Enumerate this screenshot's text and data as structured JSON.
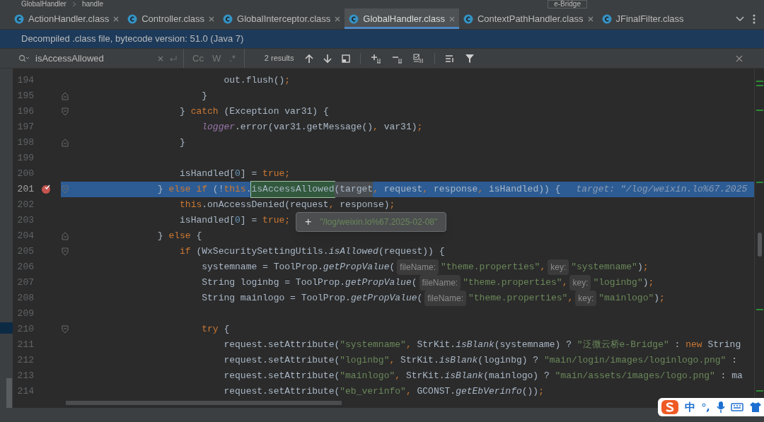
{
  "breadcrumb": [
    "GlobalHandler",
    "handle"
  ],
  "run_config": "e-Bridge",
  "tabs": [
    {
      "label": "ActionHandler.class",
      "selected": false,
      "closable": true
    },
    {
      "label": "Controller.class",
      "selected": false,
      "closable": true
    },
    {
      "label": "GlobalInterceptor.class",
      "selected": false,
      "closable": true
    },
    {
      "label": "GlobalHandler.class",
      "selected": true,
      "closable": true
    },
    {
      "label": "ContextPathHandler.class",
      "selected": false,
      "closable": true
    },
    {
      "label": "JFinalFilter.class",
      "selected": false,
      "closable": false
    }
  ],
  "banner": "Decompiled .class file, bytecode version: 51.0 (Java 7)",
  "search": {
    "query": "isAccessAllowed",
    "toggles": [
      "Cc",
      "W",
      ".*"
    ],
    "results": "2 results"
  },
  "lines": [
    {
      "number": "194",
      "kind": "plain",
      "current": false,
      "breakpoint": false,
      "tokens": [
        {
          "kind": "plain",
          "text": "                            out.flush()"
        },
        {
          "kind": "punct",
          "text": ";"
        }
      ]
    },
    {
      "number": "195",
      "kind": "fold-end",
      "current": false,
      "breakpoint": false,
      "tokens": [
        {
          "kind": "plain",
          "text": "                        }"
        }
      ]
    },
    {
      "number": "196",
      "kind": "fold-start",
      "current": false,
      "breakpoint": false,
      "tokens": [
        {
          "kind": "plain",
          "text": "                    } "
        },
        {
          "kind": "keyword",
          "text": "catch"
        },
        {
          "kind": "plain",
          "text": " (Exception var31) {"
        }
      ]
    },
    {
      "number": "197",
      "kind": "plain",
      "current": false,
      "breakpoint": false,
      "tokens": [
        {
          "kind": "field",
          "text": "                        logger"
        },
        {
          "kind": "plain",
          "text": ".error(var31.getMessage()"
        },
        {
          "kind": "punct",
          "text": ","
        },
        {
          "kind": "plain",
          "text": " var31)"
        },
        {
          "kind": "punct",
          "text": ";"
        }
      ]
    },
    {
      "number": "198",
      "kind": "fold-end",
      "current": false,
      "breakpoint": false,
      "tokens": [
        {
          "kind": "plain",
          "text": "                    }"
        }
      ]
    },
    {
      "number": "199",
      "kind": "plain",
      "current": false,
      "breakpoint": false
    },
    {
      "number": "200",
      "kind": "plain",
      "current": false,
      "breakpoint": false,
      "tokens": [
        {
          "kind": "plain",
          "text": "                    isHandled["
        },
        {
          "kind": "number",
          "text": "0"
        },
        {
          "kind": "plain",
          "text": "] = "
        },
        {
          "kind": "keyword",
          "text": "true"
        },
        {
          "kind": "punct",
          "text": ";"
        }
      ]
    },
    {
      "number": "201",
      "kind": "fold-start",
      "current": true,
      "breakpoint": true,
      "tokens": [
        {
          "kind": "plain",
          "text": "                } "
        },
        {
          "kind": "keyword",
          "text": "else if"
        },
        {
          "kind": "plain",
          "text": " (!"
        },
        {
          "kind": "keyword",
          "text": "this"
        },
        {
          "kind": "plain",
          "text": "."
        },
        {
          "kind": "match",
          "text": "isAccessAllowed"
        },
        {
          "kind": "hover",
          "text": "(target"
        },
        {
          "kind": "punct",
          "text": ","
        },
        {
          "kind": "plain",
          "text": " request"
        },
        {
          "kind": "punct",
          "text": ","
        },
        {
          "kind": "plain",
          "text": " response"
        },
        {
          "kind": "punct",
          "text": ","
        },
        {
          "kind": "plain",
          "text": " isHandled)) {"
        },
        {
          "kind": "debug",
          "text": "target: \"/log/weixin.lo%67.2025"
        }
      ]
    },
    {
      "number": "202",
      "kind": "plain",
      "current": false,
      "breakpoint": false,
      "tokens": [
        {
          "kind": "keyword",
          "text": "                    this"
        },
        {
          "kind": "plain",
          "text": ".onAccessDenied(request"
        },
        {
          "kind": "punct",
          "text": ","
        },
        {
          "kind": "plain",
          "text": " response)"
        },
        {
          "kind": "punct",
          "text": ";"
        }
      ]
    },
    {
      "number": "203",
      "kind": "plain",
      "current": false,
      "breakpoint": false,
      "tokens": [
        {
          "kind": "plain",
          "text": "                    isHandled["
        },
        {
          "kind": "number",
          "text": "0"
        },
        {
          "kind": "plain",
          "text": "] = "
        },
        {
          "kind": "keyword",
          "text": "true"
        },
        {
          "kind": "punct",
          "text": ";"
        }
      ]
    },
    {
      "number": "204",
      "kind": "fold-end",
      "current": false,
      "breakpoint": false,
      "tokens": [
        {
          "kind": "plain",
          "text": "                } "
        },
        {
          "kind": "keyword",
          "text": "else"
        },
        {
          "kind": "plain",
          "text": " {"
        }
      ]
    },
    {
      "number": "205",
      "kind": "fold-start",
      "current": false,
      "breakpoint": false,
      "tokens": [
        {
          "kind": "keyword",
          "text": "                    if"
        },
        {
          "kind": "plain",
          "text": " (WxSecuritySettingUtils."
        },
        {
          "kind": "static",
          "text": "isAllowed"
        },
        {
          "kind": "plain",
          "text": "(request)) {"
        }
      ]
    },
    {
      "number": "206",
      "kind": "plain",
      "current": false,
      "breakpoint": false,
      "tokens": [
        {
          "kind": "plain",
          "text": "                        systemname = ToolProp."
        },
        {
          "kind": "static",
          "text": "getPropValue"
        },
        {
          "kind": "plain",
          "text": "("
        },
        {
          "kind": "hint",
          "text": "fileName:"
        },
        {
          "kind": "string",
          "text": "\"theme.properties\""
        },
        {
          "kind": "punct",
          "text": ","
        },
        {
          "kind": "hint",
          "text": "key:"
        },
        {
          "kind": "string",
          "text": "\"systemname\""
        },
        {
          "kind": "plain",
          "text": ")"
        },
        {
          "kind": "punct",
          "text": ";"
        }
      ]
    },
    {
      "number": "207",
      "kind": "plain",
      "current": false,
      "breakpoint": false,
      "tokens": [
        {
          "kind": "plain",
          "text": "                        String loginbg = ToolProp."
        },
        {
          "kind": "static",
          "text": "getPropValue"
        },
        {
          "kind": "plain",
          "text": "("
        },
        {
          "kind": "hint",
          "text": "fileName:"
        },
        {
          "kind": "string",
          "text": "\"theme.properties\""
        },
        {
          "kind": "punct",
          "text": ","
        },
        {
          "kind": "hint",
          "text": "key:"
        },
        {
          "kind": "string",
          "text": "\"loginbg\""
        },
        {
          "kind": "plain",
          "text": ")"
        },
        {
          "kind": "punct",
          "text": ";"
        }
      ]
    },
    {
      "number": "208",
      "kind": "plain",
      "current": false,
      "breakpoint": false,
      "tokens": [
        {
          "kind": "plain",
          "text": "                        String mainlogo = ToolProp."
        },
        {
          "kind": "static",
          "text": "getPropValue"
        },
        {
          "kind": "plain",
          "text": "("
        },
        {
          "kind": "hint",
          "text": "fileName:"
        },
        {
          "kind": "string",
          "text": "\"theme.properties\""
        },
        {
          "kind": "punct",
          "text": ","
        },
        {
          "kind": "hint",
          "text": "key:"
        },
        {
          "kind": "string",
          "text": "\"mainlogo\""
        },
        {
          "kind": "plain",
          "text": ")"
        },
        {
          "kind": "punct",
          "text": ";"
        }
      ]
    },
    {
      "number": "209",
      "kind": "plain",
      "current": false,
      "breakpoint": false
    },
    {
      "number": "210",
      "kind": "fold-start",
      "current": false,
      "breakpoint": false,
      "tokens": [
        {
          "kind": "keyword",
          "text": "                        try"
        },
        {
          "kind": "plain",
          "text": " {"
        }
      ]
    },
    {
      "number": "211",
      "kind": "plain",
      "current": false,
      "breakpoint": false,
      "tokens": [
        {
          "kind": "plain",
          "text": "                            request.setAttribute("
        },
        {
          "kind": "string",
          "text": "\"systemname\""
        },
        {
          "kind": "punct",
          "text": ","
        },
        {
          "kind": "plain",
          "text": " StrKit."
        },
        {
          "kind": "static",
          "text": "isBlank"
        },
        {
          "kind": "plain",
          "text": "(systemname) ? "
        },
        {
          "kind": "string",
          "text": "\"泛微云桥e-Bridge\""
        },
        {
          "kind": "plain",
          "text": " : "
        },
        {
          "kind": "keyword",
          "text": "new"
        },
        {
          "kind": "plain",
          "text": " String"
        }
      ]
    },
    {
      "number": "212",
      "kind": "plain",
      "current": false,
      "breakpoint": false,
      "tokens": [
        {
          "kind": "plain",
          "text": "                            request.setAttribute("
        },
        {
          "kind": "string",
          "text": "\"loginbg\""
        },
        {
          "kind": "punct",
          "text": ","
        },
        {
          "kind": "plain",
          "text": " StrKit."
        },
        {
          "kind": "static",
          "text": "isBlank"
        },
        {
          "kind": "plain",
          "text": "(loginbg) ? "
        },
        {
          "kind": "string",
          "text": "\"main/login/images/loginlogo.png\""
        },
        {
          "kind": "plain",
          "text": " :"
        }
      ]
    },
    {
      "number": "213",
      "kind": "plain",
      "current": false,
      "breakpoint": false,
      "tokens": [
        {
          "kind": "plain",
          "text": "                            request.setAttribute("
        },
        {
          "kind": "string",
          "text": "\"mainlogo\""
        },
        {
          "kind": "punct",
          "text": ","
        },
        {
          "kind": "plain",
          "text": " StrKit."
        },
        {
          "kind": "static",
          "text": "isBlank"
        },
        {
          "kind": "plain",
          "text": "(mainlogo) ? "
        },
        {
          "kind": "string",
          "text": "\"main/assets/images/logo.png\""
        },
        {
          "kind": "plain",
          "text": " : ma"
        }
      ]
    },
    {
      "number": "214",
      "kind": "plain",
      "current": false,
      "breakpoint": false,
      "tokens": [
        {
          "kind": "plain",
          "text": "                            request.setAttribute("
        },
        {
          "kind": "string",
          "text": "\"eb_verinfo\""
        },
        {
          "kind": "punct",
          "text": ","
        },
        {
          "kind": "plain",
          "text": " GCONST."
        },
        {
          "kind": "static",
          "text": "getEbVerinfo"
        },
        {
          "kind": "plain",
          "text": "())"
        },
        {
          "kind": "punct",
          "text": ";"
        }
      ]
    }
  ],
  "value_popup": {
    "expand": "+",
    "value": "\"/log/weixin.lo%67.2025-02-08\""
  },
  "ime_toolbar": {
    "mode": "中"
  }
}
